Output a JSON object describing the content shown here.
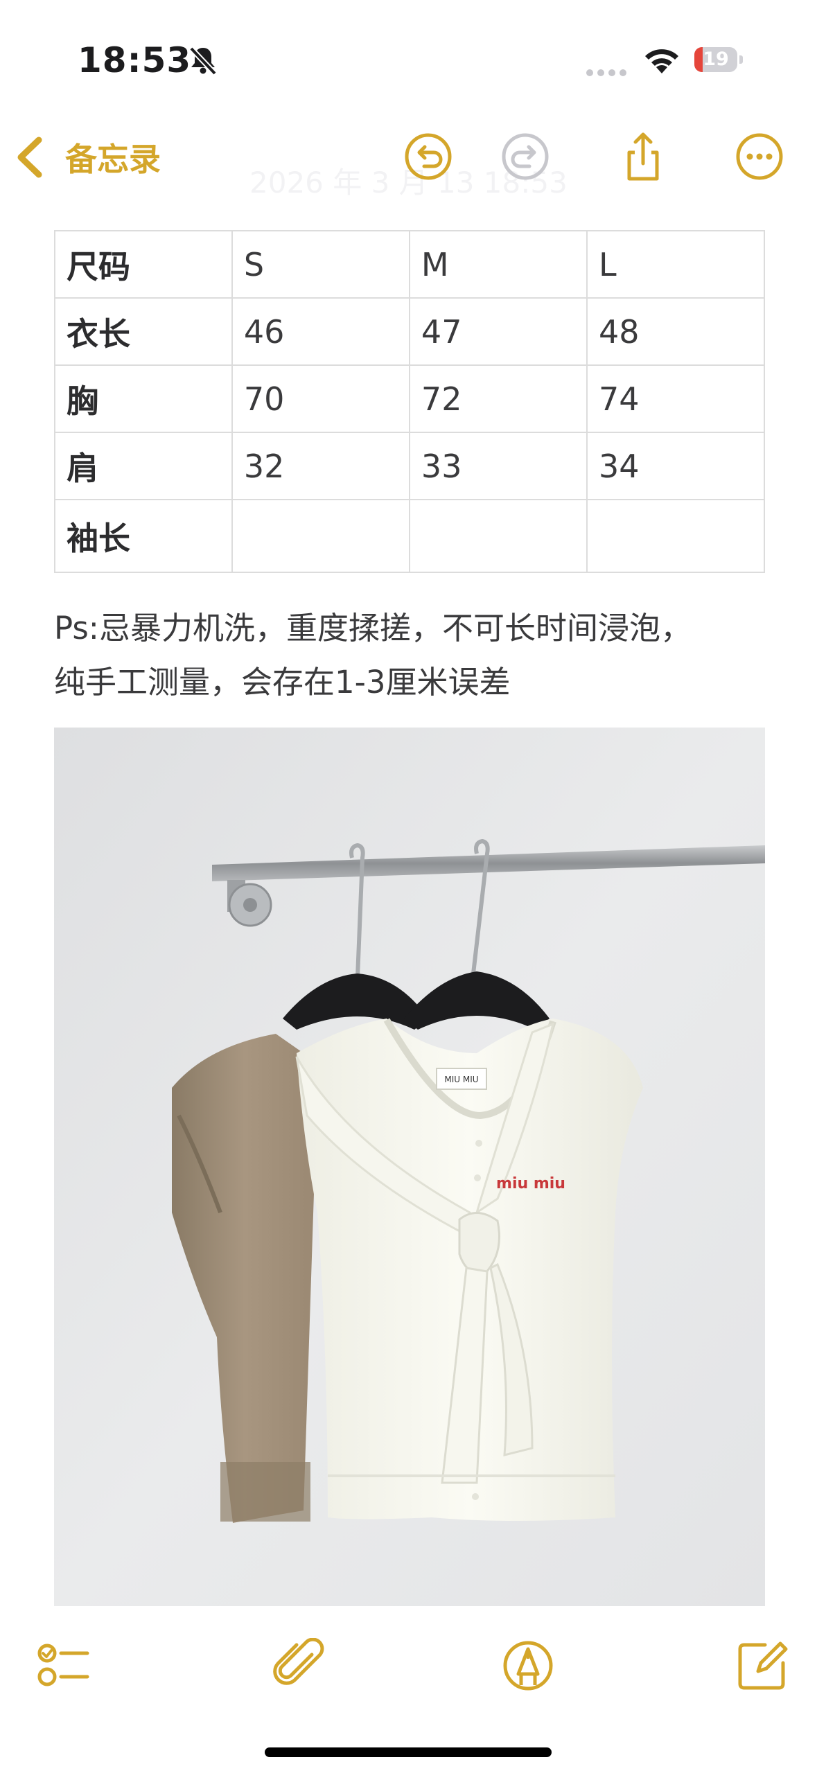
{
  "status_bar": {
    "time": "18:53",
    "battery_level": "19",
    "icons": [
      "bell-slash-icon",
      "cellular-icon",
      "wifi-icon",
      "battery-icon"
    ]
  },
  "nav": {
    "back_label": "备忘录",
    "faded_date": "2026 年 3 月 13 18:53",
    "icons": [
      "chevron-left-icon",
      "undo-icon",
      "redo-icon",
      "share-icon",
      "more-icon"
    ],
    "accent_color": "#d4a62a"
  },
  "size_table": {
    "rows": [
      [
        "尺码",
        "S",
        "M",
        "L"
      ],
      [
        "衣长",
        "46",
        "47",
        "48"
      ],
      [
        "胸",
        "70",
        "72",
        "74"
      ],
      [
        "肩",
        "32",
        "33",
        "34"
      ],
      [
        "袖长",
        "",
        "",
        ""
      ]
    ]
  },
  "note": {
    "line1": "Ps:忌暴力机洗，重度揉搓，不可长时间浸泡，",
    "line2": "纯手工测量，会存在1-3厘米误差"
  },
  "photo": {
    "label_text": "MIU MIU",
    "logo_text": "miu miu"
  },
  "toolbar": {
    "icons": [
      "checklist-icon",
      "paperclip-icon",
      "markup-pen-icon",
      "compose-icon"
    ]
  }
}
